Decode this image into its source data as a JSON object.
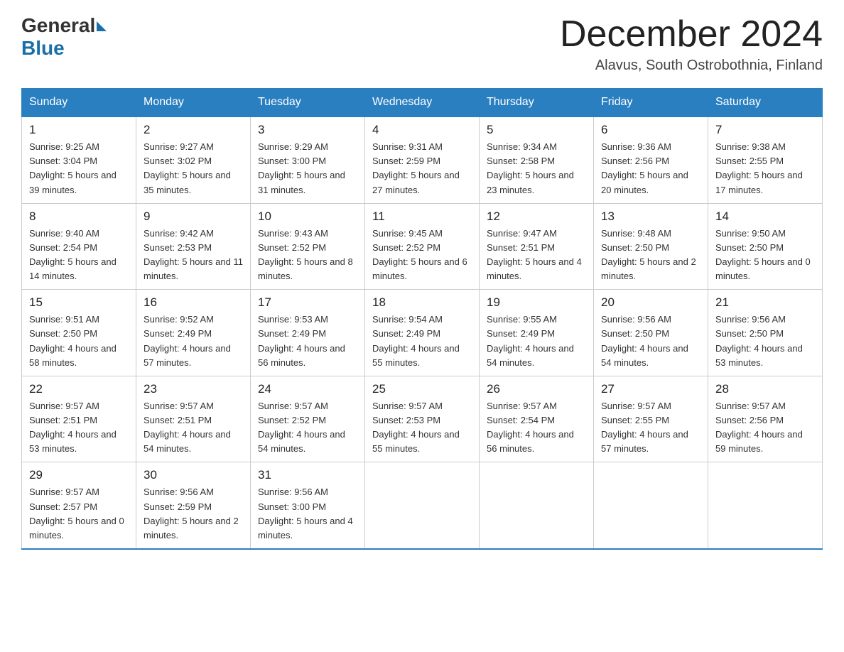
{
  "header": {
    "logo_general": "General",
    "logo_blue": "Blue",
    "month_title": "December 2024",
    "location": "Alavus, South Ostrobothnia, Finland"
  },
  "weekdays": [
    "Sunday",
    "Monday",
    "Tuesday",
    "Wednesday",
    "Thursday",
    "Friday",
    "Saturday"
  ],
  "weeks": [
    [
      {
        "day": "1",
        "sunrise": "9:25 AM",
        "sunset": "3:04 PM",
        "daylight": "5 hours and 39 minutes."
      },
      {
        "day": "2",
        "sunrise": "9:27 AM",
        "sunset": "3:02 PM",
        "daylight": "5 hours and 35 minutes."
      },
      {
        "day": "3",
        "sunrise": "9:29 AM",
        "sunset": "3:00 PM",
        "daylight": "5 hours and 31 minutes."
      },
      {
        "day": "4",
        "sunrise": "9:31 AM",
        "sunset": "2:59 PM",
        "daylight": "5 hours and 27 minutes."
      },
      {
        "day": "5",
        "sunrise": "9:34 AM",
        "sunset": "2:58 PM",
        "daylight": "5 hours and 23 minutes."
      },
      {
        "day": "6",
        "sunrise": "9:36 AM",
        "sunset": "2:56 PM",
        "daylight": "5 hours and 20 minutes."
      },
      {
        "day": "7",
        "sunrise": "9:38 AM",
        "sunset": "2:55 PM",
        "daylight": "5 hours and 17 minutes."
      }
    ],
    [
      {
        "day": "8",
        "sunrise": "9:40 AM",
        "sunset": "2:54 PM",
        "daylight": "5 hours and 14 minutes."
      },
      {
        "day": "9",
        "sunrise": "9:42 AM",
        "sunset": "2:53 PM",
        "daylight": "5 hours and 11 minutes."
      },
      {
        "day": "10",
        "sunrise": "9:43 AM",
        "sunset": "2:52 PM",
        "daylight": "5 hours and 8 minutes."
      },
      {
        "day": "11",
        "sunrise": "9:45 AM",
        "sunset": "2:52 PM",
        "daylight": "5 hours and 6 minutes."
      },
      {
        "day": "12",
        "sunrise": "9:47 AM",
        "sunset": "2:51 PM",
        "daylight": "5 hours and 4 minutes."
      },
      {
        "day": "13",
        "sunrise": "9:48 AM",
        "sunset": "2:50 PM",
        "daylight": "5 hours and 2 minutes."
      },
      {
        "day": "14",
        "sunrise": "9:50 AM",
        "sunset": "2:50 PM",
        "daylight": "5 hours and 0 minutes."
      }
    ],
    [
      {
        "day": "15",
        "sunrise": "9:51 AM",
        "sunset": "2:50 PM",
        "daylight": "4 hours and 58 minutes."
      },
      {
        "day": "16",
        "sunrise": "9:52 AM",
        "sunset": "2:49 PM",
        "daylight": "4 hours and 57 minutes."
      },
      {
        "day": "17",
        "sunrise": "9:53 AM",
        "sunset": "2:49 PM",
        "daylight": "4 hours and 56 minutes."
      },
      {
        "day": "18",
        "sunrise": "9:54 AM",
        "sunset": "2:49 PM",
        "daylight": "4 hours and 55 minutes."
      },
      {
        "day": "19",
        "sunrise": "9:55 AM",
        "sunset": "2:49 PM",
        "daylight": "4 hours and 54 minutes."
      },
      {
        "day": "20",
        "sunrise": "9:56 AM",
        "sunset": "2:50 PM",
        "daylight": "4 hours and 54 minutes."
      },
      {
        "day": "21",
        "sunrise": "9:56 AM",
        "sunset": "2:50 PM",
        "daylight": "4 hours and 53 minutes."
      }
    ],
    [
      {
        "day": "22",
        "sunrise": "9:57 AM",
        "sunset": "2:51 PM",
        "daylight": "4 hours and 53 minutes."
      },
      {
        "day": "23",
        "sunrise": "9:57 AM",
        "sunset": "2:51 PM",
        "daylight": "4 hours and 54 minutes."
      },
      {
        "day": "24",
        "sunrise": "9:57 AM",
        "sunset": "2:52 PM",
        "daylight": "4 hours and 54 minutes."
      },
      {
        "day": "25",
        "sunrise": "9:57 AM",
        "sunset": "2:53 PM",
        "daylight": "4 hours and 55 minutes."
      },
      {
        "day": "26",
        "sunrise": "9:57 AM",
        "sunset": "2:54 PM",
        "daylight": "4 hours and 56 minutes."
      },
      {
        "day": "27",
        "sunrise": "9:57 AM",
        "sunset": "2:55 PM",
        "daylight": "4 hours and 57 minutes."
      },
      {
        "day": "28",
        "sunrise": "9:57 AM",
        "sunset": "2:56 PM",
        "daylight": "4 hours and 59 minutes."
      }
    ],
    [
      {
        "day": "29",
        "sunrise": "9:57 AM",
        "sunset": "2:57 PM",
        "daylight": "5 hours and 0 minutes."
      },
      {
        "day": "30",
        "sunrise": "9:56 AM",
        "sunset": "2:59 PM",
        "daylight": "5 hours and 2 minutes."
      },
      {
        "day": "31",
        "sunrise": "9:56 AM",
        "sunset": "3:00 PM",
        "daylight": "5 hours and 4 minutes."
      },
      null,
      null,
      null,
      null
    ]
  ]
}
